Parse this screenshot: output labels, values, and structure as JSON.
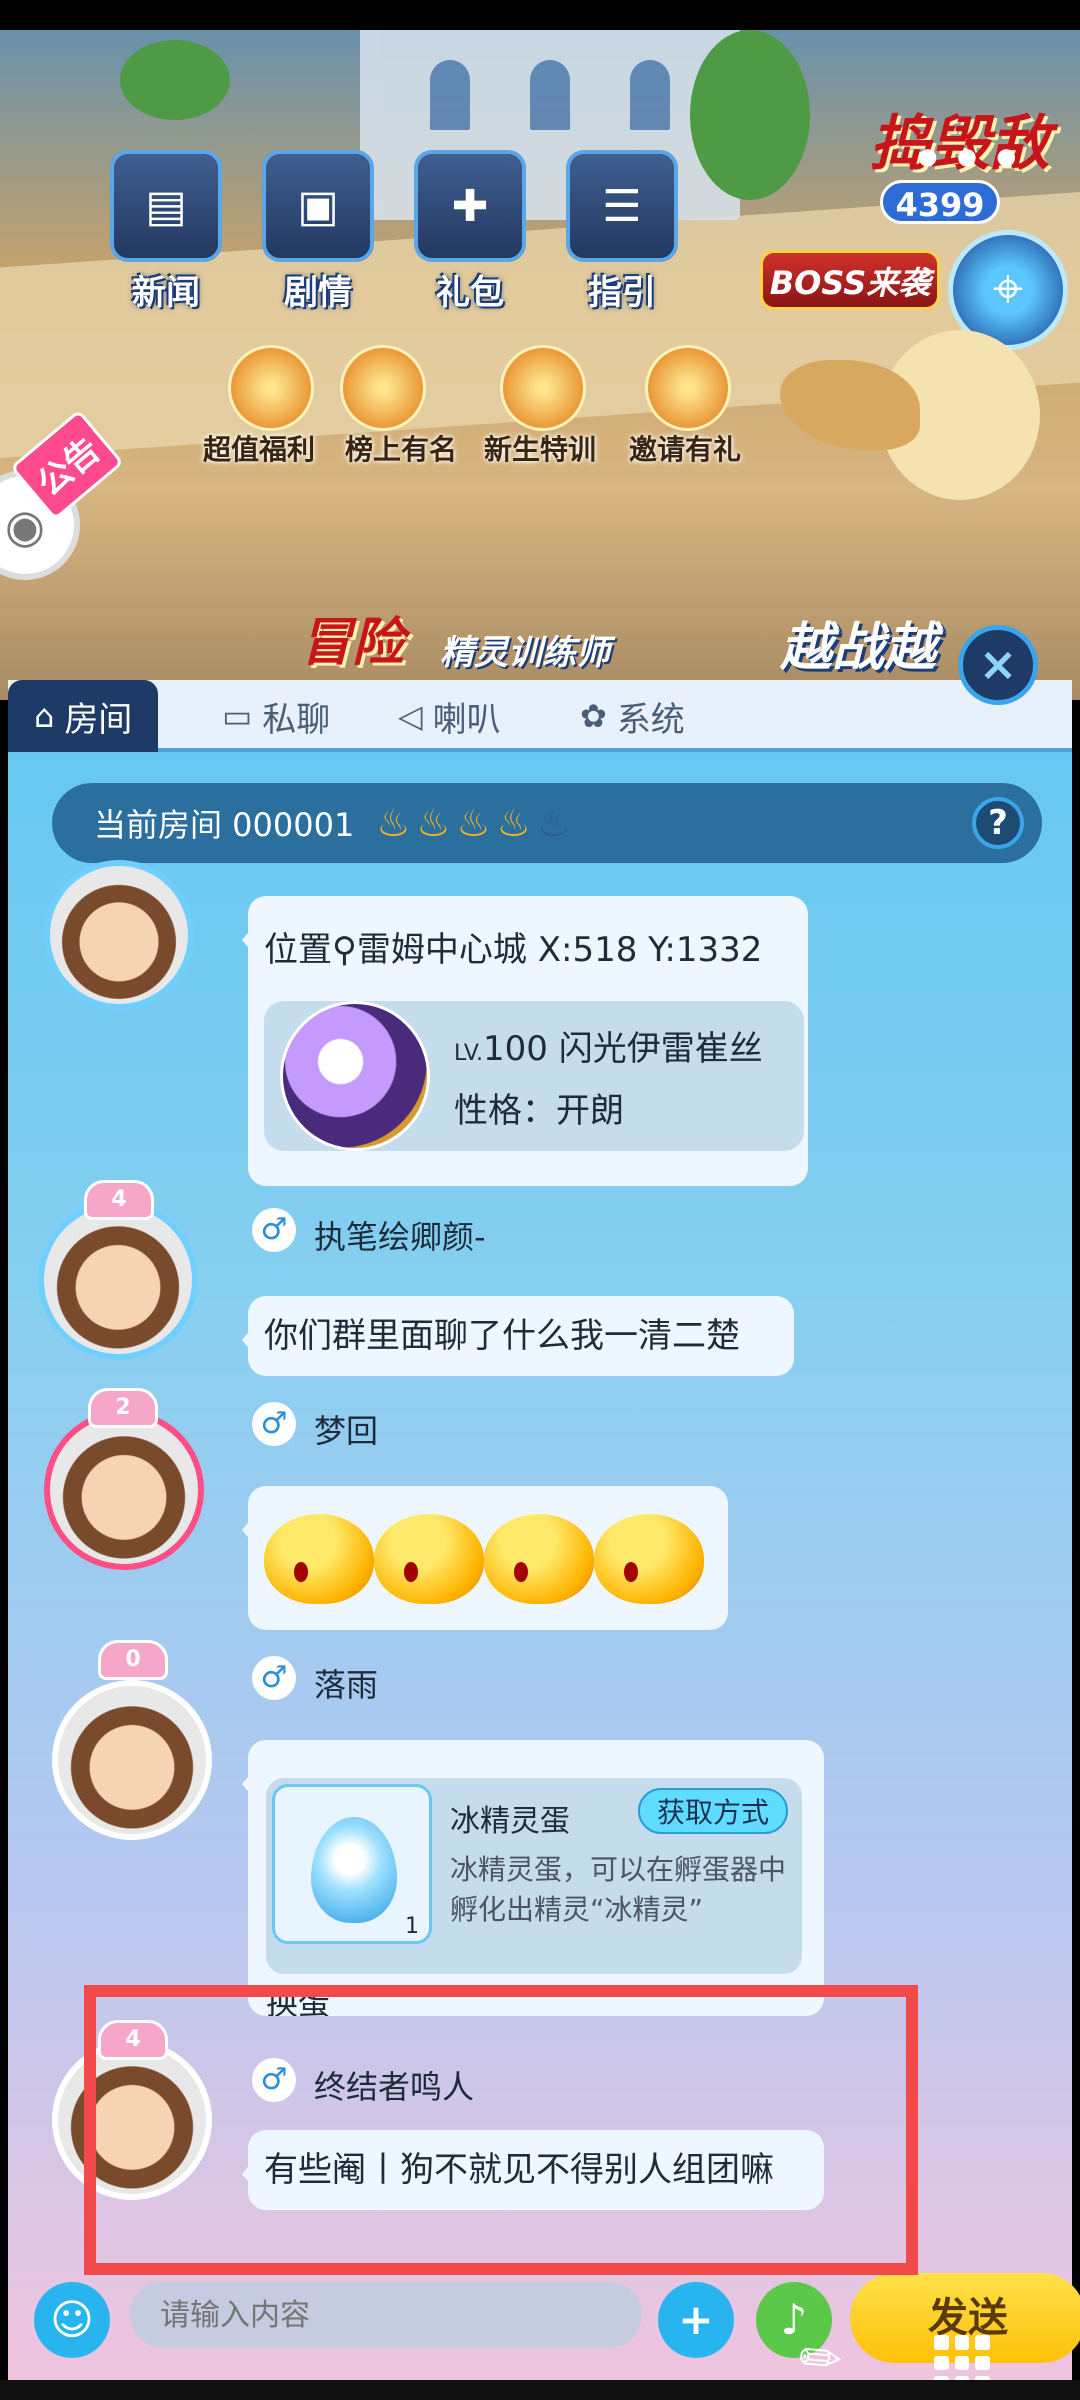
{
  "game": {
    "top_menu": [
      {
        "label": "新闻",
        "icon": "news-icon"
      },
      {
        "label": "剧情",
        "icon": "story-icon"
      },
      {
        "label": "礼包",
        "icon": "gift-icon"
      },
      {
        "label": "指引",
        "icon": "guide-icon"
      }
    ],
    "sub_menu": [
      {
        "label": "超值福利",
        "icon": "bonus-icon"
      },
      {
        "label": "榜上有名",
        "icon": "trophy-icon"
      },
      {
        "label": "新生特训",
        "icon": "training-icon"
      },
      {
        "label": "邀请有礼",
        "icon": "invite-icon"
      }
    ],
    "banner_right": "捣毁敌",
    "score_badge": "4399",
    "boss_label": "BOSS来袭",
    "event_banner": "冒险",
    "event_banner2": "精灵训练师",
    "event_banner3": "越战越",
    "notice_tag": "公告",
    "more_icon": "more-dots-icon",
    "map_icon": "map-icon"
  },
  "chat": {
    "tabs": [
      {
        "label": "房间",
        "icon": "home-icon",
        "active": true
      },
      {
        "label": "私聊",
        "icon": "monitor-icon"
      },
      {
        "label": "喇叭",
        "icon": "speaker-icon"
      },
      {
        "label": "系统",
        "icon": "pinwheel-icon"
      }
    ],
    "room": {
      "label": "当前房间 000001",
      "flames_lit": 4,
      "flames_total": 5
    },
    "messages": [
      {
        "type": "location_pet",
        "location_text": "位置",
        "location_value": "雷姆中心城 X:518 Y:1332",
        "pet_level_prefix": "LV.",
        "pet_level": "100",
        "pet_name": "闪光伊雷崔丝",
        "pet_nature": "性格：开朗"
      },
      {
        "type": "text",
        "sender": "执笔绘卿颜-",
        "badge": "4",
        "text": "你们群里面聊了什么我一清二楚"
      },
      {
        "type": "emoji",
        "sender": "梦回",
        "badge": "2",
        "emoji_count": 4
      },
      {
        "type": "item",
        "sender": "落雨",
        "badge": "0",
        "item_name": "冰精灵蛋",
        "item_desc": "冰精灵蛋，可以在孵蛋器中孵化出精灵“冰精灵”",
        "item_count": "1",
        "get_button": "获取方式",
        "extra_text": "换蛋"
      },
      {
        "type": "text",
        "sender": "终结者鸣人",
        "badge": "4",
        "text": "有些阉丨狗不就见不得别人组团嘛"
      }
    ],
    "input_placeholder": "请输入内容",
    "send_label": "发送"
  },
  "colors": {
    "highlight": "#f24a4a",
    "tab_active": "#1e3a66",
    "send": "#ffc107"
  }
}
